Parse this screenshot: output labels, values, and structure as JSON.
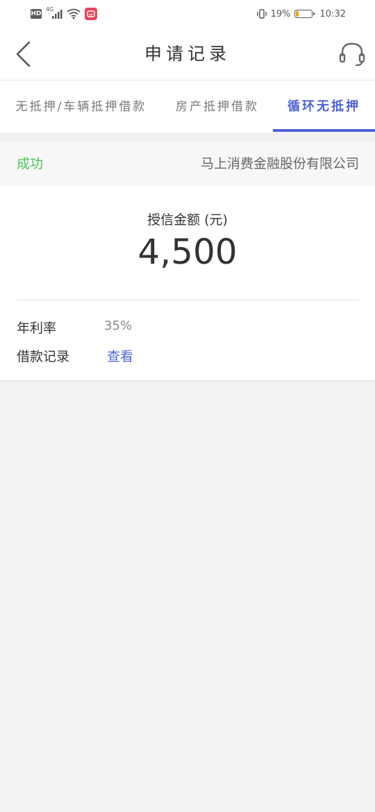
{
  "status_bar": {
    "hd_label": "HD",
    "network_label": "4G",
    "battery_text": "19%",
    "battery_level": 0.19,
    "time": "10:32",
    "icons": [
      "signal-icon",
      "wifi-icon",
      "app-notification-icon",
      "vibrate-icon",
      "battery-icon"
    ]
  },
  "header": {
    "title": "申请记录",
    "back_icon": "chevron-left-icon",
    "service_icon": "headset-icon"
  },
  "tabs": [
    {
      "label": "无抵押/车辆抵押借款",
      "active": false
    },
    {
      "label": "房产抵押借款",
      "active": false
    },
    {
      "label": "循环无抵押",
      "active": true
    }
  ],
  "record": {
    "status": "成功",
    "company": "马上消费金融股份有限公司",
    "credit_label": "授信金额 (元)",
    "credit_amount": "4,500",
    "rate_label": "年利率",
    "rate_value": "35%",
    "loan_record_label": "借款记录",
    "view_link": "查看"
  },
  "colors": {
    "accent": "#4f5fd3",
    "success": "#4fc25a",
    "link": "#4f68d8",
    "background": "#f2f2f2"
  }
}
